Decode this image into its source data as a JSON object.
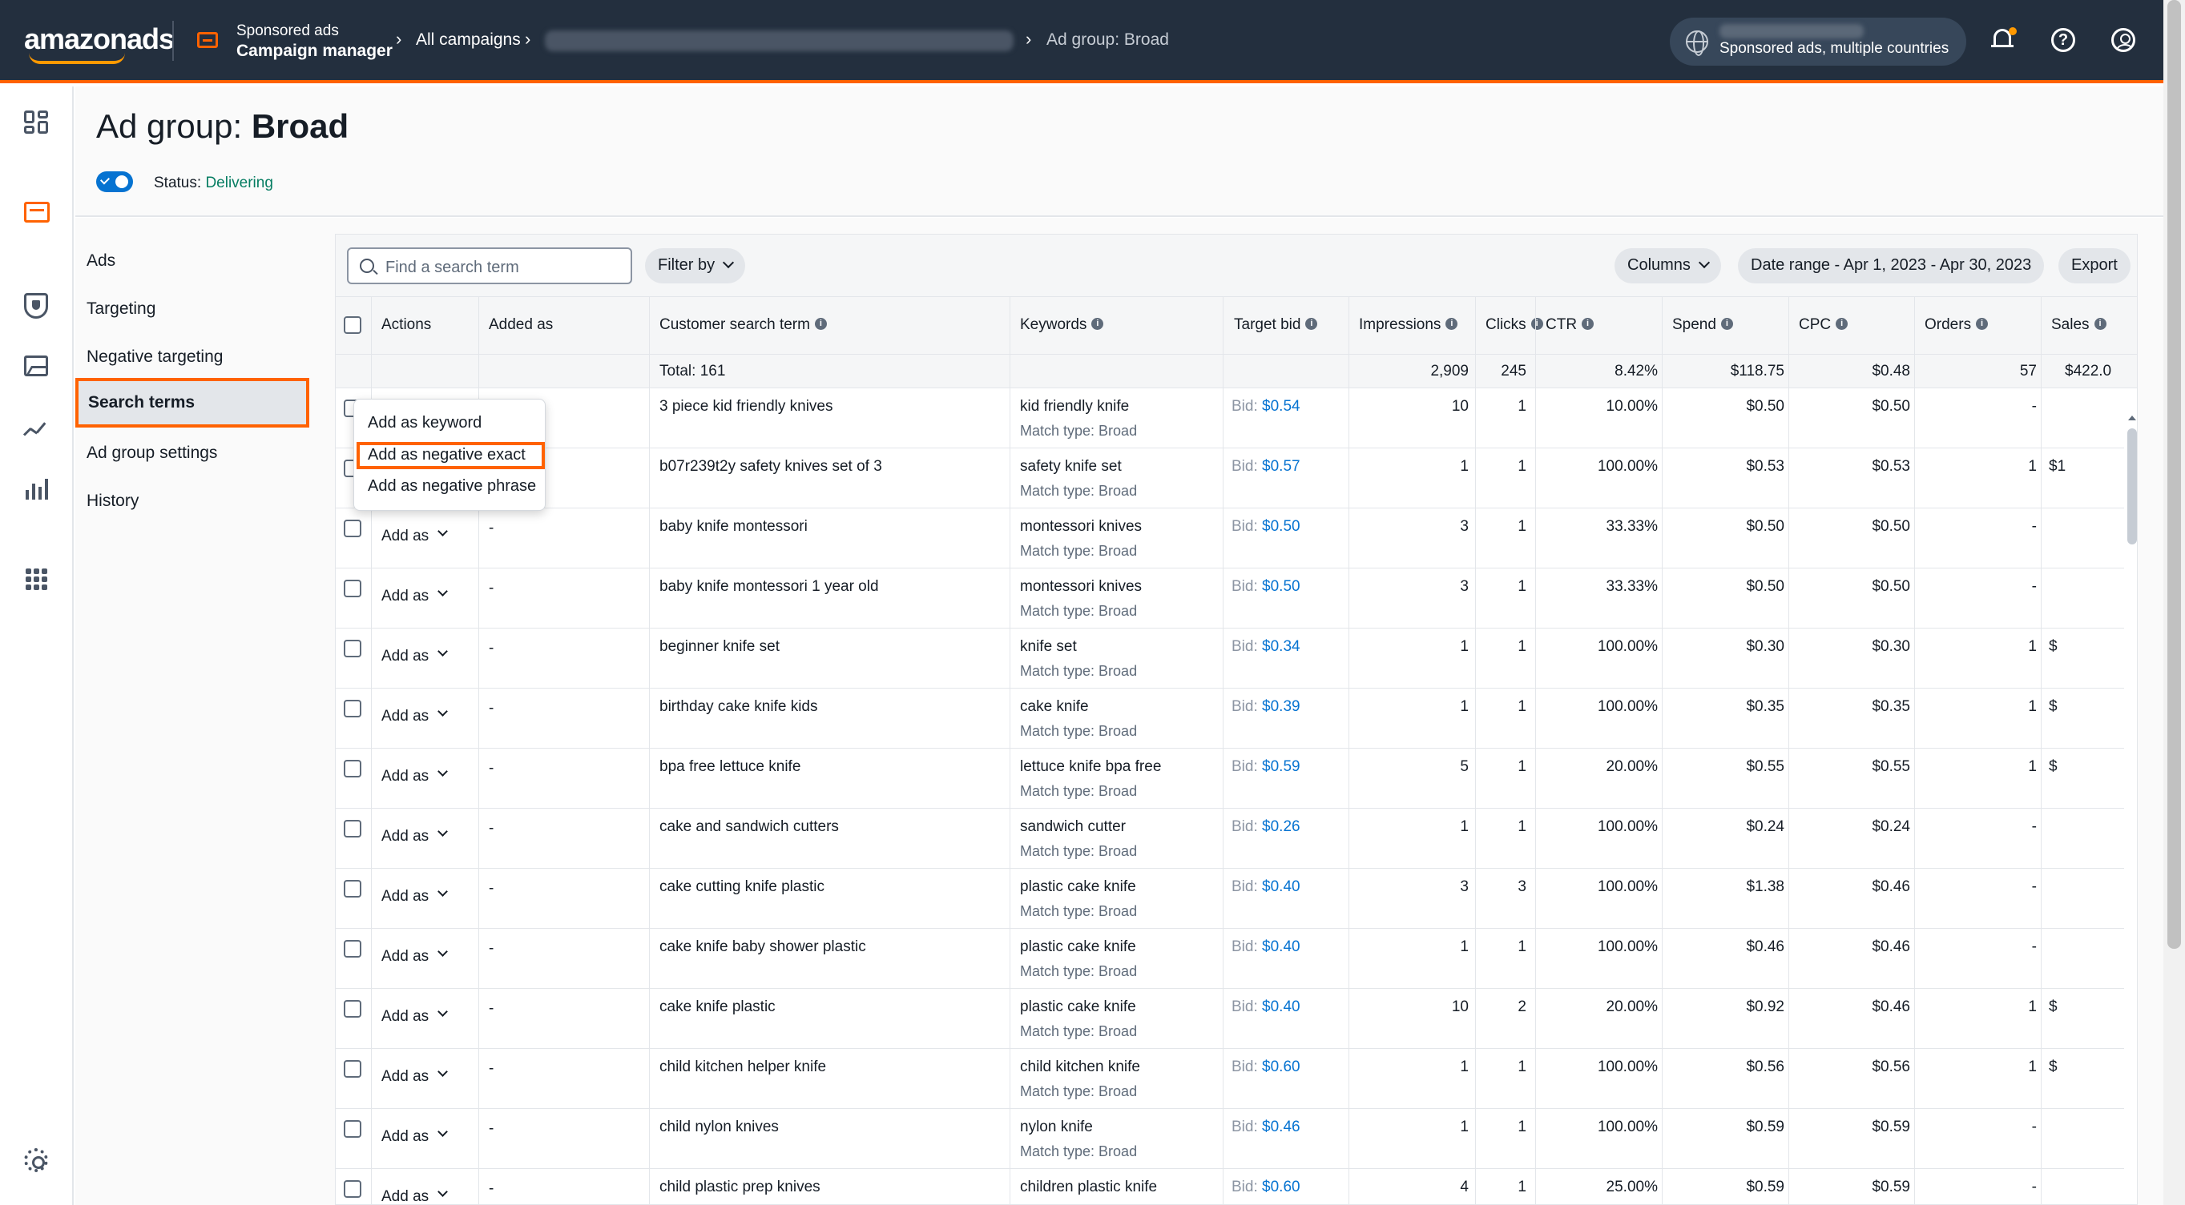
{
  "topbar": {
    "logo": "amazonads",
    "product_small": "Sponsored ads",
    "product_big": "Campaign manager",
    "crumb_all": "All campaigns",
    "crumb_current": "Ad group: Broad",
    "account_label": "Sponsored ads, multiple countries"
  },
  "header": {
    "title_prefix": "Ad group:",
    "title_name": "Broad",
    "status_label": "Status:",
    "status_value": "Delivering"
  },
  "subnav": {
    "items": [
      "Ads",
      "Targeting",
      "Negative targeting",
      "Search terms",
      "Ad group settings",
      "History"
    ],
    "active": "Search terms"
  },
  "toolbar": {
    "search_placeholder": "Find a search term",
    "filter_label": "Filter by",
    "columns_label": "Columns",
    "date_range_label": "Date range - Apr 1, 2023 - Apr 30, 2023",
    "export_label": "Export"
  },
  "table": {
    "headers": {
      "actions": "Actions",
      "added_as": "Added as",
      "search_term": "Customer search term",
      "keywords": "Keywords",
      "target_bid": "Target bid",
      "impressions": "Impressions",
      "clicks": "Clicks",
      "ctr": "CTR",
      "spend": "Spend",
      "cpc": "CPC",
      "orders": "Orders",
      "sales": "Sales"
    },
    "total": {
      "label": "Total: 161",
      "impressions": "2,909",
      "clicks": "245",
      "ctr": "8.42%",
      "spend": "$118.75",
      "cpc": "$0.48",
      "orders": "57",
      "sales": "$422.0"
    },
    "add_as_label": "Add as",
    "bid_label": "Bid:",
    "rows": [
      {
        "term": "3 piece kid friendly knives",
        "keyword": "kid friendly knife",
        "match": "Match type: Broad",
        "bid": "$0.54",
        "impressions": "10",
        "clicks": "1",
        "ctr": "10.00%",
        "spend": "$0.50",
        "cpc": "$0.50",
        "orders": "-",
        "sales": "",
        "added": "-"
      },
      {
        "term": "b07r239t2y safety knives set of 3",
        "keyword": "safety knife set",
        "match": "Match type: Broad",
        "bid": "$0.57",
        "impressions": "1",
        "clicks": "1",
        "ctr": "100.00%",
        "spend": "$0.53",
        "cpc": "$0.53",
        "orders": "1",
        "sales": "$1",
        "added": "-"
      },
      {
        "term": "baby knife montessori",
        "keyword": "montessori knives",
        "match": "Match type: Broad",
        "bid": "$0.50",
        "impressions": "3",
        "clicks": "1",
        "ctr": "33.33%",
        "spend": "$0.50",
        "cpc": "$0.50",
        "orders": "-",
        "sales": "",
        "added": "-"
      },
      {
        "term": "baby knife montessori 1 year old",
        "keyword": "montessori knives",
        "match": "Match type: Broad",
        "bid": "$0.50",
        "impressions": "3",
        "clicks": "1",
        "ctr": "33.33%",
        "spend": "$0.50",
        "cpc": "$0.50",
        "orders": "-",
        "sales": "",
        "added": "-"
      },
      {
        "term": "beginner knife set",
        "keyword": "knife set",
        "match": "Match type: Broad",
        "bid": "$0.34",
        "impressions": "1",
        "clicks": "1",
        "ctr": "100.00%",
        "spend": "$0.30",
        "cpc": "$0.30",
        "orders": "1",
        "sales": "$",
        "added": "-"
      },
      {
        "term": "birthday cake knife kids",
        "keyword": "cake knife",
        "match": "Match type: Broad",
        "bid": "$0.39",
        "impressions": "1",
        "clicks": "1",
        "ctr": "100.00%",
        "spend": "$0.35",
        "cpc": "$0.35",
        "orders": "1",
        "sales": "$",
        "added": "-"
      },
      {
        "term": "bpa free lettuce knife",
        "keyword": "lettuce knife bpa free",
        "match": "Match type: Broad",
        "bid": "$0.59",
        "impressions": "5",
        "clicks": "1",
        "ctr": "20.00%",
        "spend": "$0.55",
        "cpc": "$0.55",
        "orders": "1",
        "sales": "$",
        "added": "-"
      },
      {
        "term": "cake and sandwich cutters",
        "keyword": "sandwich cutter",
        "match": "Match type: Broad",
        "bid": "$0.26",
        "impressions": "1",
        "clicks": "1",
        "ctr": "100.00%",
        "spend": "$0.24",
        "cpc": "$0.24",
        "orders": "-",
        "sales": "",
        "added": "-"
      },
      {
        "term": "cake cutting knife plastic",
        "keyword": "plastic cake knife",
        "match": "Match type: Broad",
        "bid": "$0.40",
        "impressions": "3",
        "clicks": "3",
        "ctr": "100.00%",
        "spend": "$1.38",
        "cpc": "$0.46",
        "orders": "-",
        "sales": "",
        "added": "-"
      },
      {
        "term": "cake knife baby shower plastic",
        "keyword": "plastic cake knife",
        "match": "Match type: Broad",
        "bid": "$0.40",
        "impressions": "1",
        "clicks": "1",
        "ctr": "100.00%",
        "spend": "$0.46",
        "cpc": "$0.46",
        "orders": "-",
        "sales": "",
        "added": "-"
      },
      {
        "term": "cake knife plastic",
        "keyword": "plastic cake knife",
        "match": "Match type: Broad",
        "bid": "$0.40",
        "impressions": "10",
        "clicks": "2",
        "ctr": "20.00%",
        "spend": "$0.92",
        "cpc": "$0.46",
        "orders": "1",
        "sales": "$",
        "added": "-"
      },
      {
        "term": "child kitchen helper knife",
        "keyword": "child kitchen knife",
        "match": "Match type: Broad",
        "bid": "$0.60",
        "impressions": "1",
        "clicks": "1",
        "ctr": "100.00%",
        "spend": "$0.56",
        "cpc": "$0.56",
        "orders": "1",
        "sales": "$",
        "added": "-"
      },
      {
        "term": "child nylon knives",
        "keyword": "nylon knife",
        "match": "Match type: Broad",
        "bid": "$0.46",
        "impressions": "1",
        "clicks": "1",
        "ctr": "100.00%",
        "spend": "$0.59",
        "cpc": "$0.59",
        "orders": "-",
        "sales": "",
        "added": "-"
      },
      {
        "term": "child plastic prep knives",
        "keyword": "children plastic knife",
        "match": "Match type: Broad",
        "bid": "$0.60",
        "impressions": "4",
        "clicks": "1",
        "ctr": "25.00%",
        "spend": "$0.59",
        "cpc": "$0.59",
        "orders": "-",
        "sales": "",
        "added": "-"
      }
    ]
  },
  "dropdown_menu": {
    "items": [
      "Add as keyword",
      "Add as negative exact",
      "Add as negative phrase"
    ],
    "highlighted": "Add as negative exact"
  },
  "colors": {
    "nav_bg": "#232f3e",
    "accent_orange": "#ff6200",
    "link_blue": "#0673d1",
    "status_green": "#067d62"
  }
}
